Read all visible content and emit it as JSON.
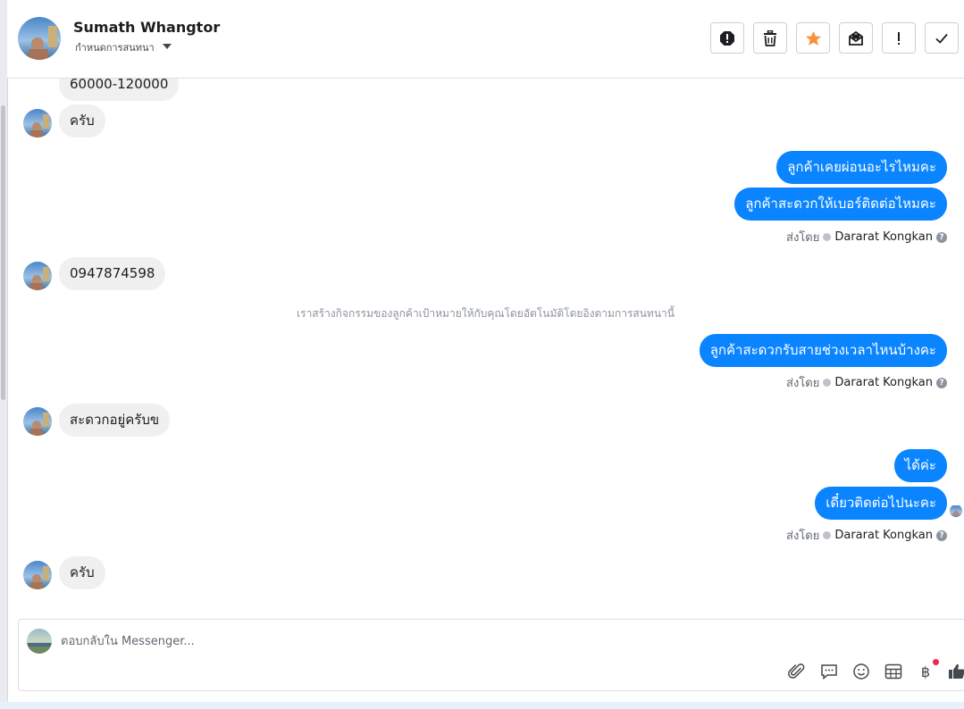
{
  "header": {
    "contact_name": "Sumath Whangtor",
    "subtitle": "กำหนดการสนทนา",
    "toolbar": [
      {
        "name": "report-spam-button",
        "icon": "alert-octagon-icon"
      },
      {
        "name": "delete-button",
        "icon": "trash-icon"
      },
      {
        "name": "star-button",
        "icon": "star-icon"
      },
      {
        "name": "mark-unread-button",
        "icon": "envelope-icon"
      },
      {
        "name": "follow-up-button",
        "icon": "exclamation-icon"
      },
      {
        "name": "mark-done-button",
        "icon": "check-icon"
      }
    ]
  },
  "thread": {
    "messages": [
      {
        "type": "in",
        "text": "60000-120000",
        "avatar": false
      },
      {
        "type": "in",
        "text": "ครับ",
        "avatar": true
      },
      {
        "type": "out",
        "text": "ลูกค้าเคยผ่อนอะไรไหมคะ"
      },
      {
        "type": "out",
        "text": "ลูกค้าสะดวกให้เบอร์ติดต่อไหมคะ"
      },
      {
        "type": "sent_by",
        "label": "ส่งโดย",
        "agent": "Dararat Kongkan"
      },
      {
        "type": "in",
        "text": "0947874598",
        "avatar": true
      },
      {
        "type": "system",
        "text": "เราสร้างกิจกรรมของลูกค้าเป้าหมายให้กับคุณโดยอัตโนมัติโดยอิงตามการสนทนานี้"
      },
      {
        "type": "out",
        "text": "ลูกค้าสะดวกรับสายช่วงเวลาไหนบ้างคะ"
      },
      {
        "type": "sent_by",
        "label": "ส่งโดย",
        "agent": "Dararat Kongkan"
      },
      {
        "type": "in",
        "text": "สะดวกอยู่ครับข",
        "avatar": true
      },
      {
        "type": "out",
        "text": "ได้ค่ะ"
      },
      {
        "type": "out",
        "text": "เดี๋ยวติดต่อไปนะคะ"
      },
      {
        "type": "sent_by",
        "label": "ส่งโดย",
        "agent": "Dararat Kongkan"
      },
      {
        "type": "in",
        "text": "ครับ",
        "avatar": true
      }
    ]
  },
  "composer": {
    "placeholder": "ตอบกลับใน Messenger...",
    "value": "",
    "icons": [
      "paperclip-icon",
      "saved-reply-icon",
      "emoji-icon",
      "appointment-icon",
      "payment-icon",
      "thumbs-up-icon"
    ]
  },
  "colors": {
    "outgoing_bubble": "#0a84ff",
    "incoming_bubble": "#f0f0f0",
    "star": "#f7923b",
    "notification": "#f02849"
  }
}
